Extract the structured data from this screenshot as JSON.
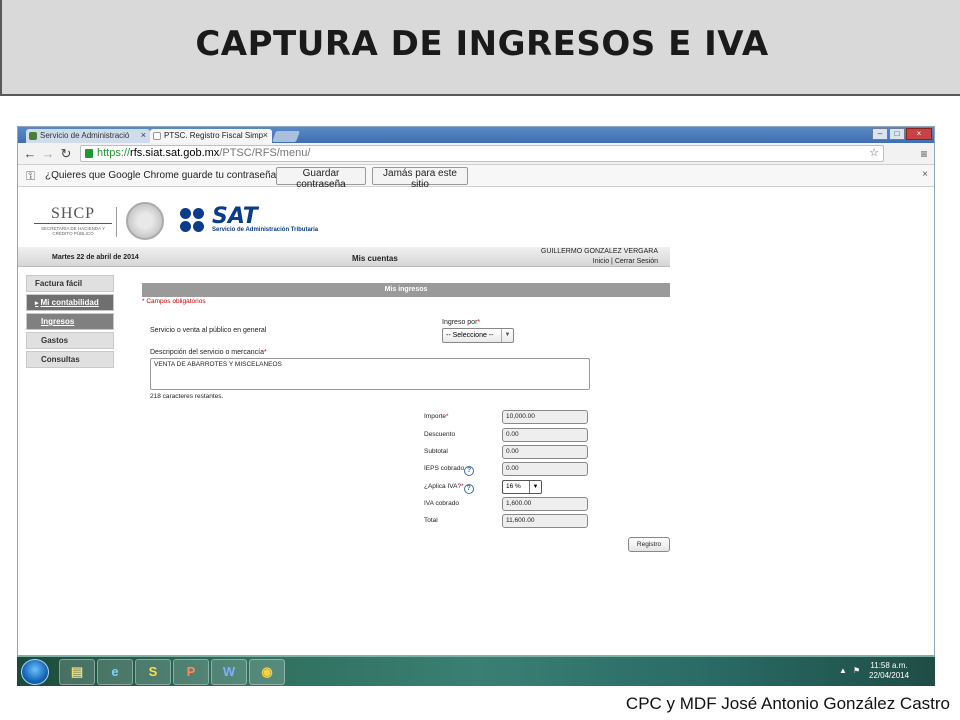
{
  "slide": {
    "title": "CAPTURA DE INGRESOS E IVA",
    "footer": "CPC y MDF José Antonio González Castro"
  },
  "browser": {
    "tabs": [
      {
        "label": "Servicio de Administració"
      },
      {
        "label": "PTSC. Registro Fiscal Simp"
      }
    ],
    "url": {
      "scheme": "https://",
      "host": "rfs.siat.sat.gob.mx",
      "path": "/PTSC/RFS/menu/"
    },
    "infobar": {
      "message": "¿Quieres que Google Chrome guarde tu contraseña?",
      "save_label": "Guardar contraseña",
      "never_label": "Jamás para este sitio",
      "close": "×"
    }
  },
  "header": {
    "shcp": "SHCP",
    "shcp_sub": "SECRETARÍA DE HACIENDA Y CRÉDITO PÚBLICO",
    "sat": "SAT",
    "sat_sub": "Servicio de Administración Tributaria",
    "date": "Martes 22 de abril de 2014",
    "section": "Mis cuentas",
    "user": "GUILLERMO GONZALEZ VERGARA",
    "links": "Inicio | Cerrar Sesión"
  },
  "sidebar": {
    "items": [
      {
        "label": "Factura fácil"
      },
      {
        "label": "Mi contabilidad"
      },
      {
        "label": "Ingresos"
      },
      {
        "label": "Gastos"
      },
      {
        "label": "Consultas"
      }
    ]
  },
  "form": {
    "heading": "Mis ingresos",
    "required_note": "* Campos obligatorios",
    "service_label": "Servicio o venta al público en general",
    "ingreso_por_label": "Ingreso por",
    "ingreso_por_value": "-- Seleccione --",
    "description_label": "Descripción del servicio o mercancía",
    "description_value": "VENTA DE ABARROTES Y MISCELANEOS",
    "remaining": "218 caracteres restantes.",
    "fields": {
      "importe": {
        "label": "Importe",
        "value": "10,000.00"
      },
      "descuento": {
        "label": "Descuento",
        "value": "0.00"
      },
      "subtotal": {
        "label": "Subtotal",
        "value": "0.00"
      },
      "ieps": {
        "label": "IEPS cobrado",
        "value": "0.00"
      },
      "aplica_iva": {
        "label": "¿Aplica IVA?",
        "value": "16 %"
      },
      "iva_cobrado": {
        "label": "IVA cobrado",
        "value": "1,600.00"
      },
      "total": {
        "label": "Total",
        "value": "11,600.00"
      }
    },
    "submit_label": "Registro"
  },
  "taskbar": {
    "time": "11:58 a.m.",
    "date": "22/04/2014"
  },
  "colors": {
    "sat_blue": "#0b3c8c",
    "required_red": "#cc0000",
    "secure_green": "#1e9b2c"
  }
}
